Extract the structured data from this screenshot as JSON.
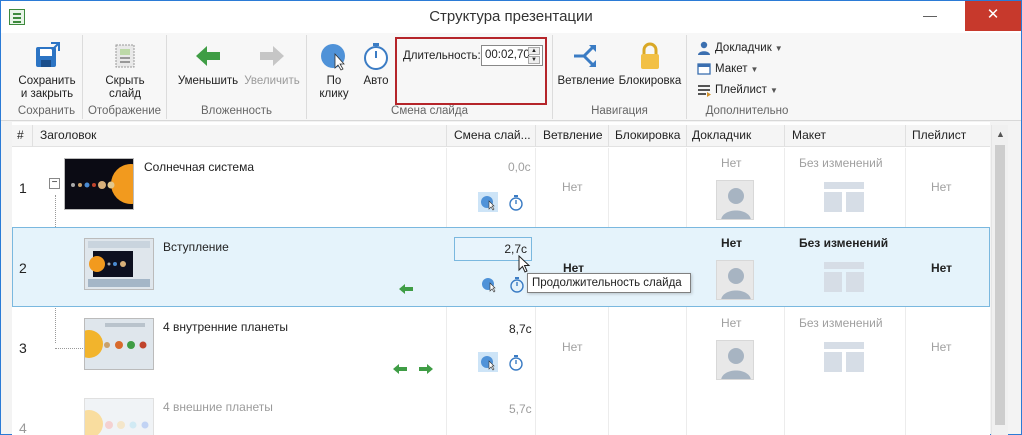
{
  "window": {
    "title": "Структура презентации",
    "minimize": "—",
    "maximize": "□",
    "close": "✕"
  },
  "ribbon": {
    "groups": {
      "save": {
        "label": "Сохранить",
        "button_line1": "Сохранить",
        "button_line2": "и закрыть"
      },
      "display": {
        "label": "Отображение",
        "button_line1": "Скрыть",
        "button_line2": "слайд"
      },
      "nesting": {
        "label": "Вложенность",
        "decrease": "Уменьшить",
        "increase": "Увеличить"
      },
      "slide_change": {
        "label": "Смена слайда",
        "on_click_line1": "По",
        "on_click_line2": "клику",
        "auto": "Авто",
        "duration_label": "Длительность:",
        "duration_value": "00:02,70"
      },
      "navigation": {
        "label": "Навигация",
        "branching": "Ветвление",
        "lock": "Блокировка"
      },
      "extra": {
        "label": "Дополнительно",
        "narrator": "Докладчик",
        "layout": "Макет",
        "playlist": "Плейлист"
      }
    }
  },
  "table": {
    "columns": {
      "num": "#",
      "title": "Заголовок",
      "slide_change": "Смена слай...",
      "branching": "Ветвление",
      "lock": "Блокировка",
      "narrator": "Докладчик",
      "layout": "Макет",
      "playlist": "Плейлист"
    },
    "rows": [
      {
        "num": "1",
        "title": "Солнечная система",
        "timing": "0,0с",
        "branching": "Нет",
        "narrator": "Нет",
        "layout": "Без изменений",
        "playlist": "Нет"
      },
      {
        "num": "2",
        "title": "Вступление",
        "timing": "2,7с",
        "branching": "Нет",
        "narrator": "Нет",
        "layout": "Без изменений",
        "playlist": "Нет"
      },
      {
        "num": "3",
        "title": "4 внутренние планеты",
        "timing": "8,7с",
        "branching": "Нет",
        "narrator": "Нет",
        "layout": "Без изменений",
        "playlist": "Нет"
      },
      {
        "num": "4",
        "title": "4 внешние планеты",
        "timing": "5,7с"
      }
    ],
    "tooltip": "Продолжительность слайда"
  },
  "colors": {
    "accent": "#2b7bd6",
    "highlight_border": "#b5252a",
    "selected_row": "#e5f3fb",
    "arrow_green": "#3f9d45"
  }
}
